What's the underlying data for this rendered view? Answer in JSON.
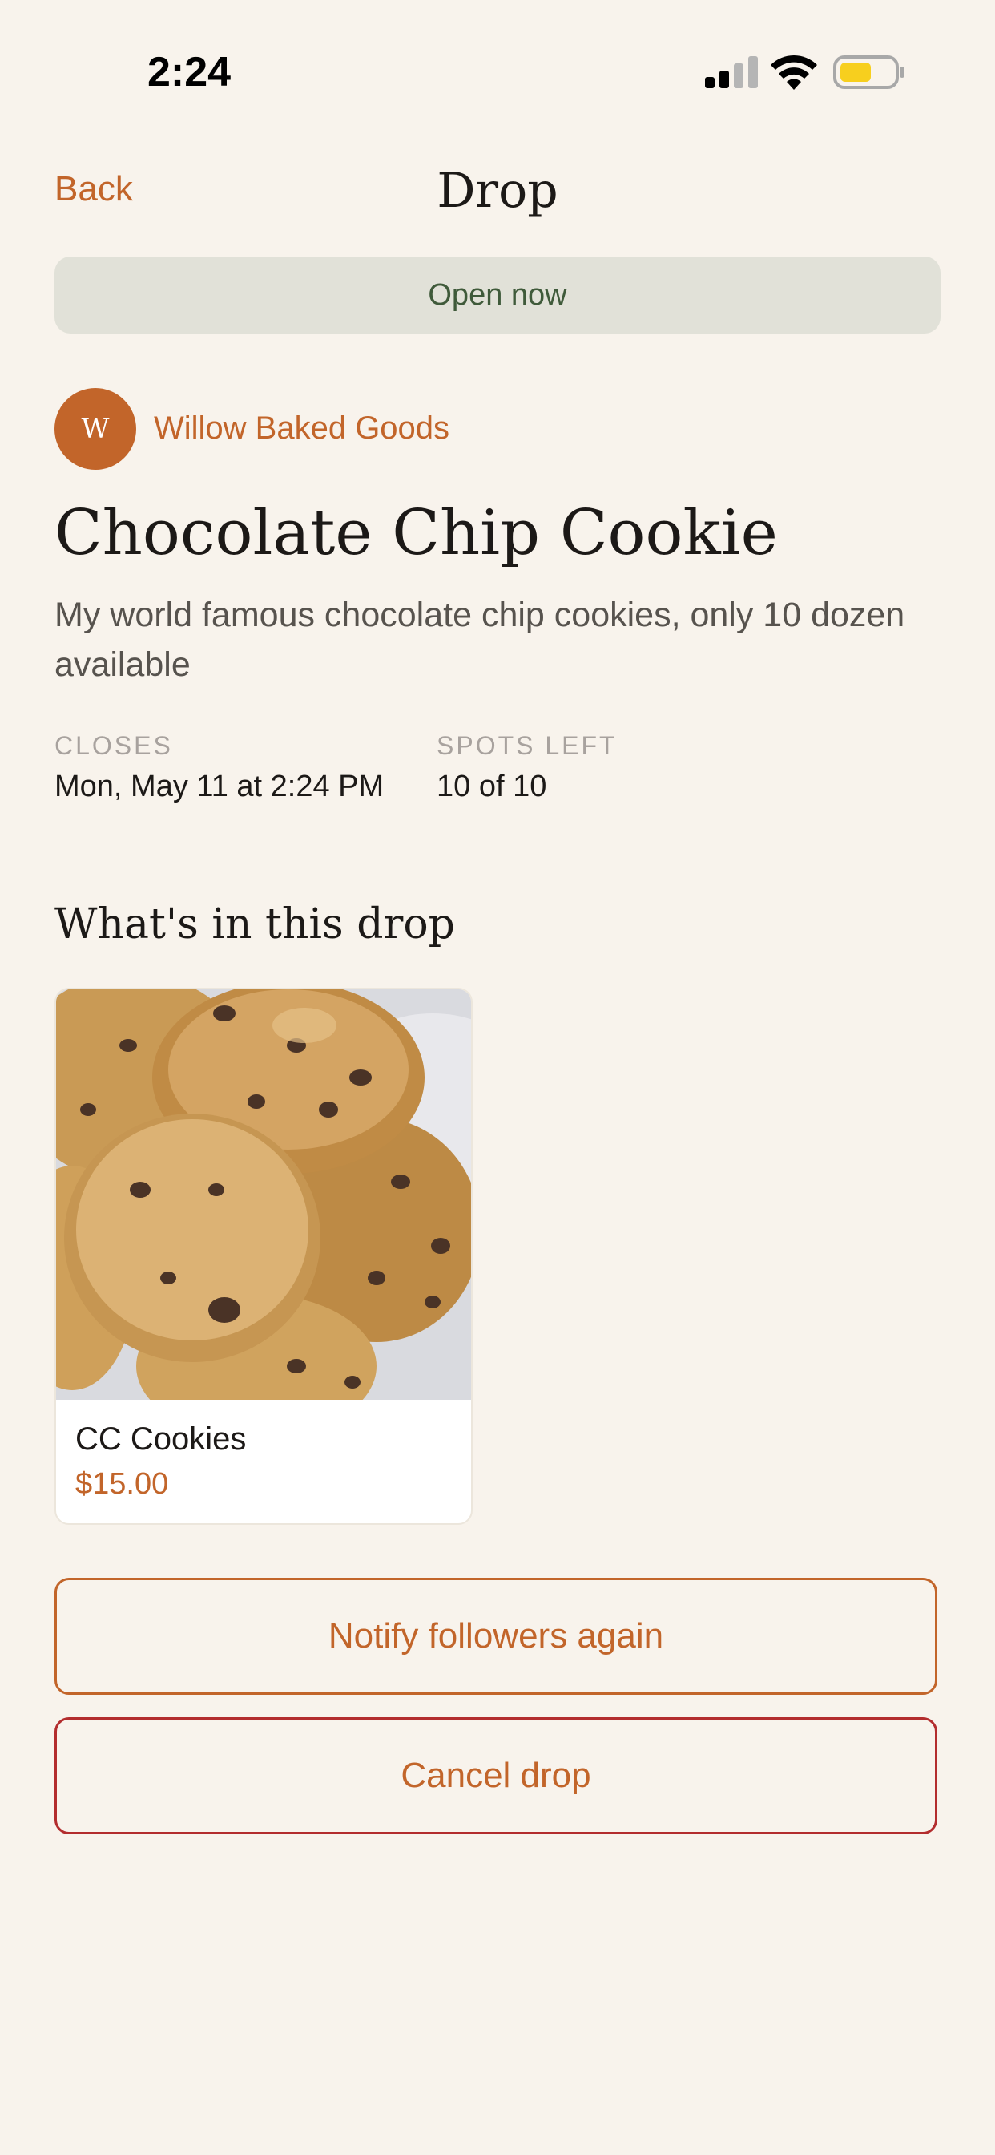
{
  "status_bar": {
    "time": "2:24",
    "icons": [
      "signal-icon",
      "wifi-icon",
      "battery-icon"
    ]
  },
  "nav": {
    "back_label": "Back",
    "title": "Drop"
  },
  "status_pill": {
    "label": "Open now"
  },
  "baker": {
    "initial": "W",
    "name": "Willow Baked Goods"
  },
  "product": {
    "title": "Chocolate Chip Cookie",
    "description": "My world famous chocolate chip cookies, only 10 dozen available"
  },
  "meta": {
    "closes_label": "CLOSES",
    "closes_value": "Mon, May 11 at 2:24 PM",
    "spots_label": "SPOTS LEFT",
    "spots_value": "10 of 10"
  },
  "section": {
    "title": "What's in this drop"
  },
  "items": [
    {
      "name": "CC Cookies",
      "price": "$15.00"
    }
  ],
  "actions": {
    "notify_label": "Notify followers again",
    "cancel_label": "Cancel drop"
  },
  "colors": {
    "background": "#f8f3ec",
    "accent": "#c2652a",
    "danger_border": "#b32d2e",
    "pill_bg": "#e1e1d8",
    "pill_text": "#3f5a3a",
    "battery_fill": "#f7cf1e"
  }
}
